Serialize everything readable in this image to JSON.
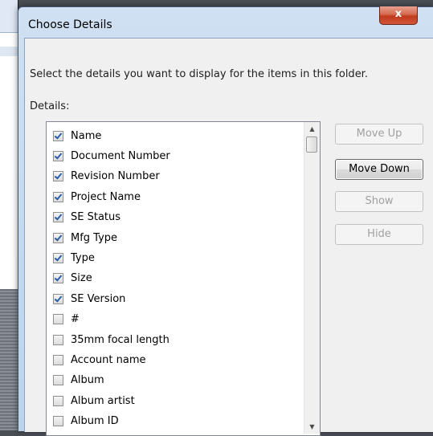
{
  "dialog": {
    "title": "Choose Details",
    "close_glyph": "x",
    "instruction": "Select the details you want to display for the items in this folder.",
    "details_label": "Details:"
  },
  "details": [
    {
      "label": "Name",
      "checked": true
    },
    {
      "label": "Document Number",
      "checked": true
    },
    {
      "label": "Revision Number",
      "checked": true
    },
    {
      "label": "Project Name",
      "checked": true
    },
    {
      "label": "SE Status",
      "checked": true
    },
    {
      "label": "Mfg Type",
      "checked": true
    },
    {
      "label": "Type",
      "checked": true
    },
    {
      "label": "Size",
      "checked": true
    },
    {
      "label": "SE Version",
      "checked": true
    },
    {
      "label": "#",
      "checked": false
    },
    {
      "label": "35mm focal length",
      "checked": false
    },
    {
      "label": "Account name",
      "checked": false
    },
    {
      "label": "Album",
      "checked": false
    },
    {
      "label": "Album artist",
      "checked": false
    },
    {
      "label": "Album ID",
      "checked": false
    }
  ],
  "buttons": {
    "move_up": "Move Up",
    "move_down": "Move Down",
    "show": "Show",
    "hide": "Hide"
  },
  "scrollbar": {
    "up_arrow": "▲",
    "down_arrow": "▼"
  },
  "colors": {
    "close_button": "#c0391c",
    "checkmark": "#2c5fa8",
    "dialog_frame": "#bcd3ea"
  }
}
